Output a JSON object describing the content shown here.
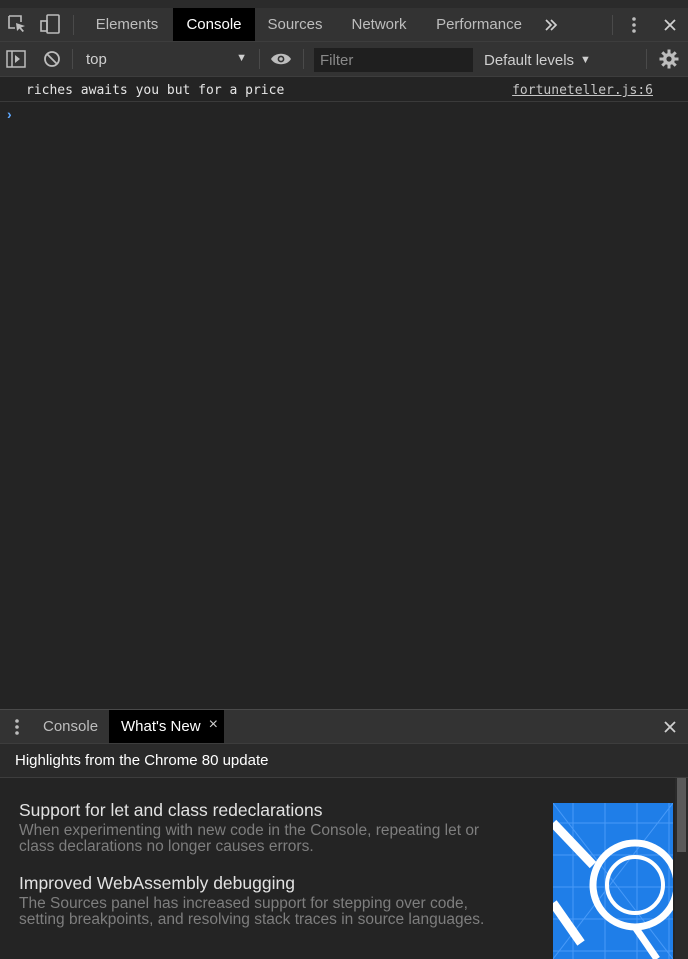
{
  "tabs": {
    "items": [
      {
        "label": "Elements"
      },
      {
        "label": "Console",
        "active": true
      },
      {
        "label": "Sources"
      },
      {
        "label": "Network"
      },
      {
        "label": "Performance"
      }
    ],
    "more_icon": "chevron-double-right-icon"
  },
  "toolbar": {
    "context": "top",
    "filter_placeholder": "Filter",
    "levels": "Default levels"
  },
  "console": {
    "messages": [
      {
        "text": "riches awaits you but for a price",
        "source": "fortuneteller.js:6"
      }
    ],
    "prompt_symbol": "›"
  },
  "drawer": {
    "tabs": [
      {
        "label": "Console"
      },
      {
        "label": "What's New",
        "active": true
      }
    ],
    "close_glyph": "×",
    "header": "Highlights from the Chrome 80 update",
    "items": [
      {
        "title": "Support for let and class redeclarations",
        "description": "When experimenting with new code in the Console, repeating let or class declarations no longer causes errors."
      },
      {
        "title": "Improved WebAssembly debugging",
        "description": "The Sources panel has increased support for stepping over code, setting breakpoints, and resolving stack traces in source languages."
      }
    ]
  },
  "colors": {
    "background": "#242424",
    "toolbar": "#333333",
    "active_tab": "#000000",
    "link": "#5fa8ff",
    "image_blue": "#1f7ee8"
  }
}
